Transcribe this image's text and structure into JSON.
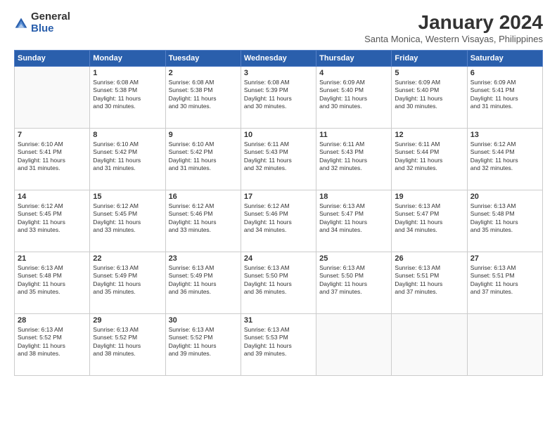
{
  "header": {
    "logo_general": "General",
    "logo_blue": "Blue",
    "month_title": "January 2024",
    "subtitle": "Santa Monica, Western Visayas, Philippines"
  },
  "days_header": [
    "Sunday",
    "Monday",
    "Tuesday",
    "Wednesday",
    "Thursday",
    "Friday",
    "Saturday"
  ],
  "weeks": [
    [
      {
        "day": "",
        "text": ""
      },
      {
        "day": "1",
        "text": "Sunrise: 6:08 AM\nSunset: 5:38 PM\nDaylight: 11 hours\nand 30 minutes."
      },
      {
        "day": "2",
        "text": "Sunrise: 6:08 AM\nSunset: 5:38 PM\nDaylight: 11 hours\nand 30 minutes."
      },
      {
        "day": "3",
        "text": "Sunrise: 6:08 AM\nSunset: 5:39 PM\nDaylight: 11 hours\nand 30 minutes."
      },
      {
        "day": "4",
        "text": "Sunrise: 6:09 AM\nSunset: 5:40 PM\nDaylight: 11 hours\nand 30 minutes."
      },
      {
        "day": "5",
        "text": "Sunrise: 6:09 AM\nSunset: 5:40 PM\nDaylight: 11 hours\nand 30 minutes."
      },
      {
        "day": "6",
        "text": "Sunrise: 6:09 AM\nSunset: 5:41 PM\nDaylight: 11 hours\nand 31 minutes."
      }
    ],
    [
      {
        "day": "7",
        "text": "Sunrise: 6:10 AM\nSunset: 5:41 PM\nDaylight: 11 hours\nand 31 minutes."
      },
      {
        "day": "8",
        "text": "Sunrise: 6:10 AM\nSunset: 5:42 PM\nDaylight: 11 hours\nand 31 minutes."
      },
      {
        "day": "9",
        "text": "Sunrise: 6:10 AM\nSunset: 5:42 PM\nDaylight: 11 hours\nand 31 minutes."
      },
      {
        "day": "10",
        "text": "Sunrise: 6:11 AM\nSunset: 5:43 PM\nDaylight: 11 hours\nand 32 minutes."
      },
      {
        "day": "11",
        "text": "Sunrise: 6:11 AM\nSunset: 5:43 PM\nDaylight: 11 hours\nand 32 minutes."
      },
      {
        "day": "12",
        "text": "Sunrise: 6:11 AM\nSunset: 5:44 PM\nDaylight: 11 hours\nand 32 minutes."
      },
      {
        "day": "13",
        "text": "Sunrise: 6:12 AM\nSunset: 5:44 PM\nDaylight: 11 hours\nand 32 minutes."
      }
    ],
    [
      {
        "day": "14",
        "text": "Sunrise: 6:12 AM\nSunset: 5:45 PM\nDaylight: 11 hours\nand 33 minutes."
      },
      {
        "day": "15",
        "text": "Sunrise: 6:12 AM\nSunset: 5:45 PM\nDaylight: 11 hours\nand 33 minutes."
      },
      {
        "day": "16",
        "text": "Sunrise: 6:12 AM\nSunset: 5:46 PM\nDaylight: 11 hours\nand 33 minutes."
      },
      {
        "day": "17",
        "text": "Sunrise: 6:12 AM\nSunset: 5:46 PM\nDaylight: 11 hours\nand 34 minutes."
      },
      {
        "day": "18",
        "text": "Sunrise: 6:13 AM\nSunset: 5:47 PM\nDaylight: 11 hours\nand 34 minutes."
      },
      {
        "day": "19",
        "text": "Sunrise: 6:13 AM\nSunset: 5:47 PM\nDaylight: 11 hours\nand 34 minutes."
      },
      {
        "day": "20",
        "text": "Sunrise: 6:13 AM\nSunset: 5:48 PM\nDaylight: 11 hours\nand 35 minutes."
      }
    ],
    [
      {
        "day": "21",
        "text": "Sunrise: 6:13 AM\nSunset: 5:48 PM\nDaylight: 11 hours\nand 35 minutes."
      },
      {
        "day": "22",
        "text": "Sunrise: 6:13 AM\nSunset: 5:49 PM\nDaylight: 11 hours\nand 35 minutes."
      },
      {
        "day": "23",
        "text": "Sunrise: 6:13 AM\nSunset: 5:49 PM\nDaylight: 11 hours\nand 36 minutes."
      },
      {
        "day": "24",
        "text": "Sunrise: 6:13 AM\nSunset: 5:50 PM\nDaylight: 11 hours\nand 36 minutes."
      },
      {
        "day": "25",
        "text": "Sunrise: 6:13 AM\nSunset: 5:50 PM\nDaylight: 11 hours\nand 37 minutes."
      },
      {
        "day": "26",
        "text": "Sunrise: 6:13 AM\nSunset: 5:51 PM\nDaylight: 11 hours\nand 37 minutes."
      },
      {
        "day": "27",
        "text": "Sunrise: 6:13 AM\nSunset: 5:51 PM\nDaylight: 11 hours\nand 37 minutes."
      }
    ],
    [
      {
        "day": "28",
        "text": "Sunrise: 6:13 AM\nSunset: 5:52 PM\nDaylight: 11 hours\nand 38 minutes."
      },
      {
        "day": "29",
        "text": "Sunrise: 6:13 AM\nSunset: 5:52 PM\nDaylight: 11 hours\nand 38 minutes."
      },
      {
        "day": "30",
        "text": "Sunrise: 6:13 AM\nSunset: 5:52 PM\nDaylight: 11 hours\nand 39 minutes."
      },
      {
        "day": "31",
        "text": "Sunrise: 6:13 AM\nSunset: 5:53 PM\nDaylight: 11 hours\nand 39 minutes."
      },
      {
        "day": "",
        "text": ""
      },
      {
        "day": "",
        "text": ""
      },
      {
        "day": "",
        "text": ""
      }
    ]
  ]
}
